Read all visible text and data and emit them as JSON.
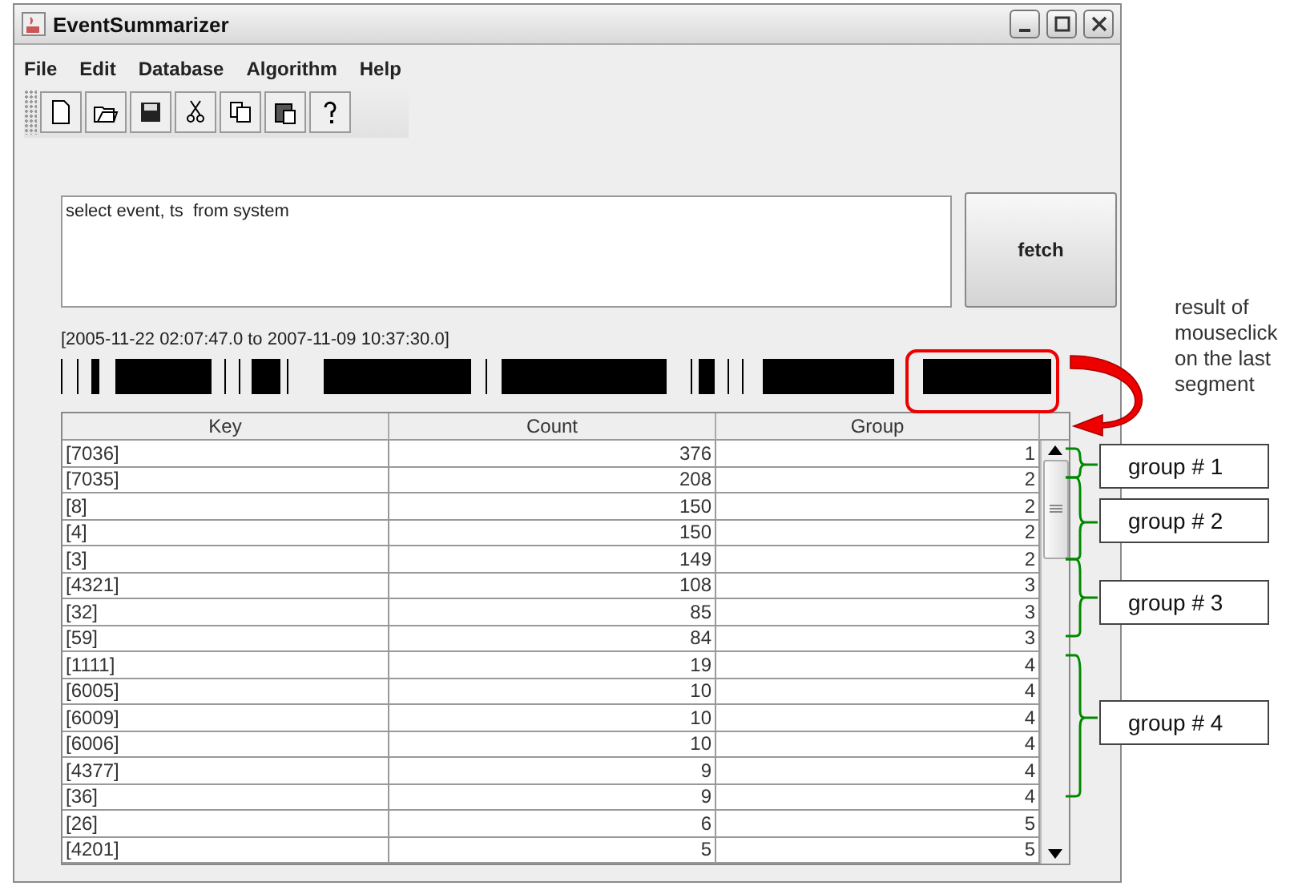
{
  "window": {
    "title": "EventSummarizer"
  },
  "menu": [
    "File",
    "Edit",
    "Database",
    "Algorithm",
    "Help"
  ],
  "query": {
    "value": "select event, ts  from system"
  },
  "fetch_button": "fetch",
  "time_range": "[2005-11-22 02:07:47.0 to 2007-11-09 10:37:30.0]",
  "table": {
    "columns": [
      "Key",
      "Count",
      "Group"
    ],
    "rows": [
      [
        "[7036]",
        "376",
        "1"
      ],
      [
        "[7035]",
        "208",
        "2"
      ],
      [
        "[8]",
        "150",
        "2"
      ],
      [
        "[4]",
        "150",
        "2"
      ],
      [
        "[3]",
        "149",
        "2"
      ],
      [
        "[4321]",
        "108",
        "3"
      ],
      [
        "[32]",
        "85",
        "3"
      ],
      [
        "[59]",
        "84",
        "3"
      ],
      [
        "[1111]",
        "19",
        "4"
      ],
      [
        "[6005]",
        "10",
        "4"
      ],
      [
        "[6009]",
        "10",
        "4"
      ],
      [
        "[6006]",
        "10",
        "4"
      ],
      [
        "[4377]",
        "9",
        "4"
      ],
      [
        "[36]",
        "9",
        "4"
      ],
      [
        "[26]",
        "6",
        "5"
      ],
      [
        "[4201]",
        "5",
        "5"
      ]
    ]
  },
  "annotations": {
    "callout": "result of mouseclick on the last segment",
    "groups": [
      "group # 1",
      "group # 2",
      "group # 3",
      "group # 4"
    ]
  }
}
